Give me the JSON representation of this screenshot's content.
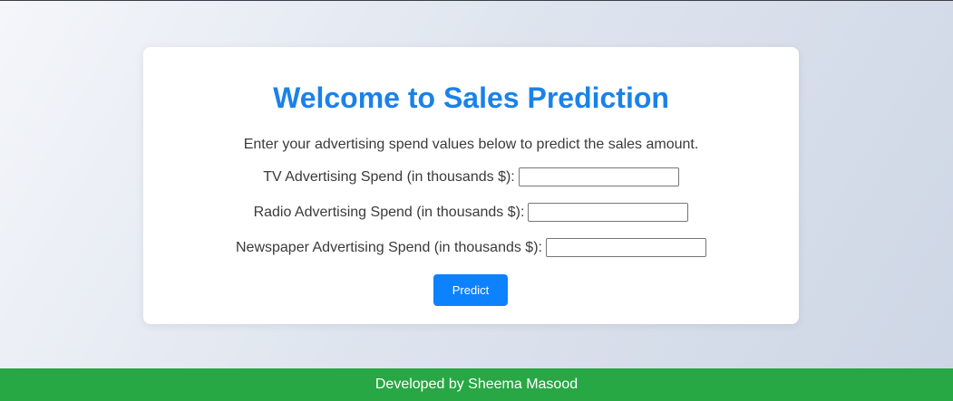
{
  "card": {
    "title": "Welcome to Sales Prediction",
    "intro": "Enter your advertising spend values below to predict the sales amount."
  },
  "form": {
    "tv_label": "TV Advertising Spend (in thousands $):",
    "tv_value": "",
    "radio_label": "Radio Advertising Spend (in thousands $):",
    "radio_value": "",
    "newspaper_label": "Newspaper Advertising Spend (in thousands $):",
    "newspaper_value": "",
    "submit_label": "Predict"
  },
  "footer": {
    "text": "Developed by Sheema Masood"
  },
  "colors": {
    "title": "#1a82e8",
    "button": "#0d82ff",
    "footer": "#28a745"
  }
}
